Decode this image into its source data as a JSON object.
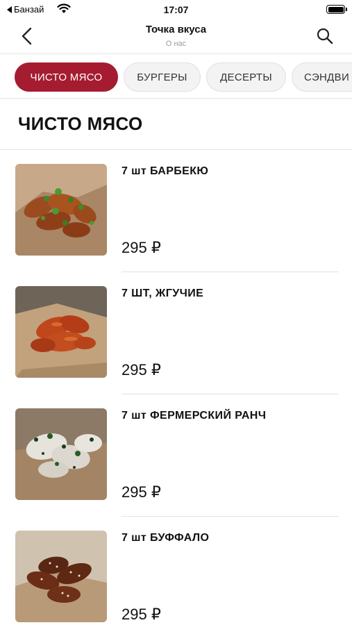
{
  "status_bar": {
    "carrier": "Банзай",
    "time": "17:07",
    "back_icon": "back-triangle-icon",
    "wifi_icon": "wifi-icon",
    "battery_icon": "battery-icon"
  },
  "nav": {
    "title": "Точка вкуса",
    "subtitle": "О нас",
    "back_icon": "chevron-left-icon",
    "search_icon": "search-icon"
  },
  "categories": [
    {
      "label": "ЧИСТО МЯСО",
      "active": true
    },
    {
      "label": "БУРГЕРЫ",
      "active": false
    },
    {
      "label": "ДЕСЕРТЫ",
      "active": false
    },
    {
      "label": "СЭНДВИ",
      "active": false
    }
  ],
  "section": {
    "title": "ЧИСТО МЯСО"
  },
  "items": [
    {
      "name": "7 шт  БАРБЕКЮ",
      "price": "295 ₽"
    },
    {
      "name": "7 ШТ, ЖГУЧИЕ",
      "price": "295 ₽"
    },
    {
      "name": "7 шт ФЕРМЕРСКИЙ РАНЧ",
      "price": "295 ₽"
    },
    {
      "name": "7 шт  БУФФАЛО",
      "price": "295 ₽"
    }
  ],
  "colors": {
    "accent": "#a51c30",
    "chip_bg": "#f3f3f3",
    "divider": "#e4e4e4",
    "subtitle": "#9a9a9a"
  }
}
